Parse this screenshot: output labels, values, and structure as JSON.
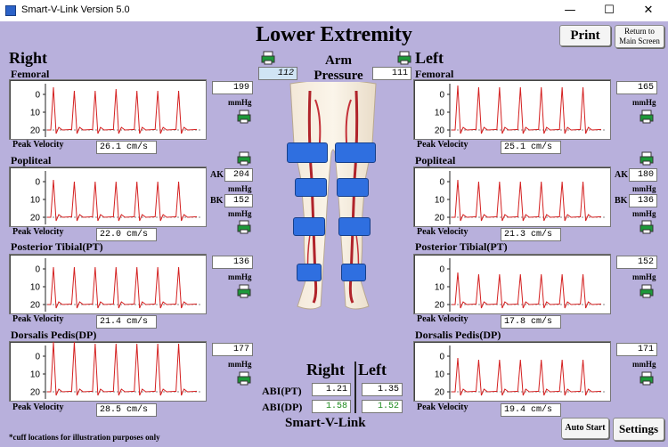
{
  "window": {
    "app_title": "Smart-V-Link   Version 5.0",
    "minimize": "—",
    "maximize": "☐",
    "close": "✕"
  },
  "header": {
    "title": "Lower Extremity",
    "print_label": "Print",
    "return_label_line1": "Return to",
    "return_label_line2": "Main Screen"
  },
  "arm_pressure": {
    "label_line1": "Arm",
    "label_line2": "Pressure",
    "right": "112",
    "left": "111"
  },
  "common": {
    "unit": "mmHg",
    "peak_velocity_label": "Peak Velocity",
    "ak": "AK",
    "bk": "BK",
    "ticks": [
      "20",
      "10",
      "0"
    ]
  },
  "right": {
    "title": "Right",
    "femoral": {
      "label": "Femoral",
      "pressure": "199",
      "velocity": "26.1 cm/s"
    },
    "popliteal": {
      "label": "Popliteal",
      "pressure_ak": "204",
      "pressure_bk": "152",
      "velocity": "22.0 cm/s"
    },
    "pt": {
      "label": "Posterior Tibial(PT)",
      "pressure": "136",
      "velocity": "21.4 cm/s"
    },
    "dp": {
      "label": "Dorsalis Pedis(DP)",
      "pressure": "177",
      "velocity": "28.5 cm/s"
    }
  },
  "left": {
    "title": "Left",
    "femoral": {
      "label": "Femoral",
      "pressure": "165",
      "velocity": "25.1 cm/s"
    },
    "popliteal": {
      "label": "Popliteal",
      "pressure_ak": "180",
      "pressure_bk": "136",
      "velocity": "21.3 cm/s"
    },
    "pt": {
      "label": "Posterior Tibial(PT)",
      "pressure": "152",
      "velocity": "17.8 cm/s"
    },
    "dp": {
      "label": "Dorsalis Pedis(DP)",
      "pressure": "171",
      "velocity": "19.4 cm/s"
    }
  },
  "abi": {
    "right_header": "Right",
    "left_header": "Left",
    "pt_label": "ABI(PT)",
    "dp_label": "ABI(DP)",
    "pt_right": "1.21",
    "pt_left": "1.35",
    "dp_right": "1.58",
    "dp_left": "1.52"
  },
  "footer": {
    "brand": "Smart-V-Link",
    "auto_start_label": "Auto Start",
    "settings_label": "Settings",
    "footnote": "*cuff locations for illustration purposes only"
  },
  "colors": {
    "waveform": "#d42020",
    "cuff": "#2f6fe0",
    "background": "#b8b0dc"
  },
  "chart_data": [
    {
      "type": "line",
      "title": "Right Femoral",
      "ylim": [
        -4,
        26
      ],
      "yticks": [
        0,
        10,
        20
      ],
      "peaks": [
        24,
        22,
        22,
        23,
        22,
        22,
        22
      ]
    },
    {
      "type": "line",
      "title": "Right Popliteal",
      "ylim": [
        -4,
        26
      ],
      "yticks": [
        0,
        10,
        20
      ],
      "peaks": [
        21,
        20,
        20,
        20,
        20,
        20,
        20
      ]
    },
    {
      "type": "line",
      "title": "Right Posterior Tibial(PT)",
      "ylim": [
        -4,
        26
      ],
      "yticks": [
        0,
        10,
        20
      ],
      "peaks": [
        21,
        21,
        21,
        21,
        21,
        21,
        21
      ]
    },
    {
      "type": "line",
      "title": "Right Dorsalis Pedis(DP)",
      "ylim": [
        -4,
        26
      ],
      "yticks": [
        0,
        10,
        20
      ],
      "peaks": [
        28,
        28,
        27,
        27,
        27,
        27,
        27
      ]
    },
    {
      "type": "line",
      "title": "Left Femoral",
      "ylim": [
        -4,
        26
      ],
      "yticks": [
        0,
        10,
        20
      ],
      "peaks": [
        25,
        24,
        24,
        24,
        24,
        24,
        24
      ]
    },
    {
      "type": "line",
      "title": "Left Popliteal",
      "ylim": [
        -4,
        26
      ],
      "yticks": [
        0,
        10,
        20
      ],
      "peaks": [
        21,
        20,
        20,
        20,
        20,
        20,
        20
      ]
    },
    {
      "type": "line",
      "title": "Left Posterior Tibial(PT)",
      "ylim": [
        -4,
        26
      ],
      "yticks": [
        0,
        10,
        20
      ],
      "peaks": [
        18,
        17,
        17,
        17,
        17,
        17,
        17
      ]
    },
    {
      "type": "line",
      "title": "Left Dorsalis Pedis(DP)",
      "ylim": [
        -4,
        26
      ],
      "yticks": [
        0,
        10,
        20
      ],
      "peaks": [
        19,
        18,
        18,
        18,
        18,
        18,
        18
      ]
    }
  ]
}
